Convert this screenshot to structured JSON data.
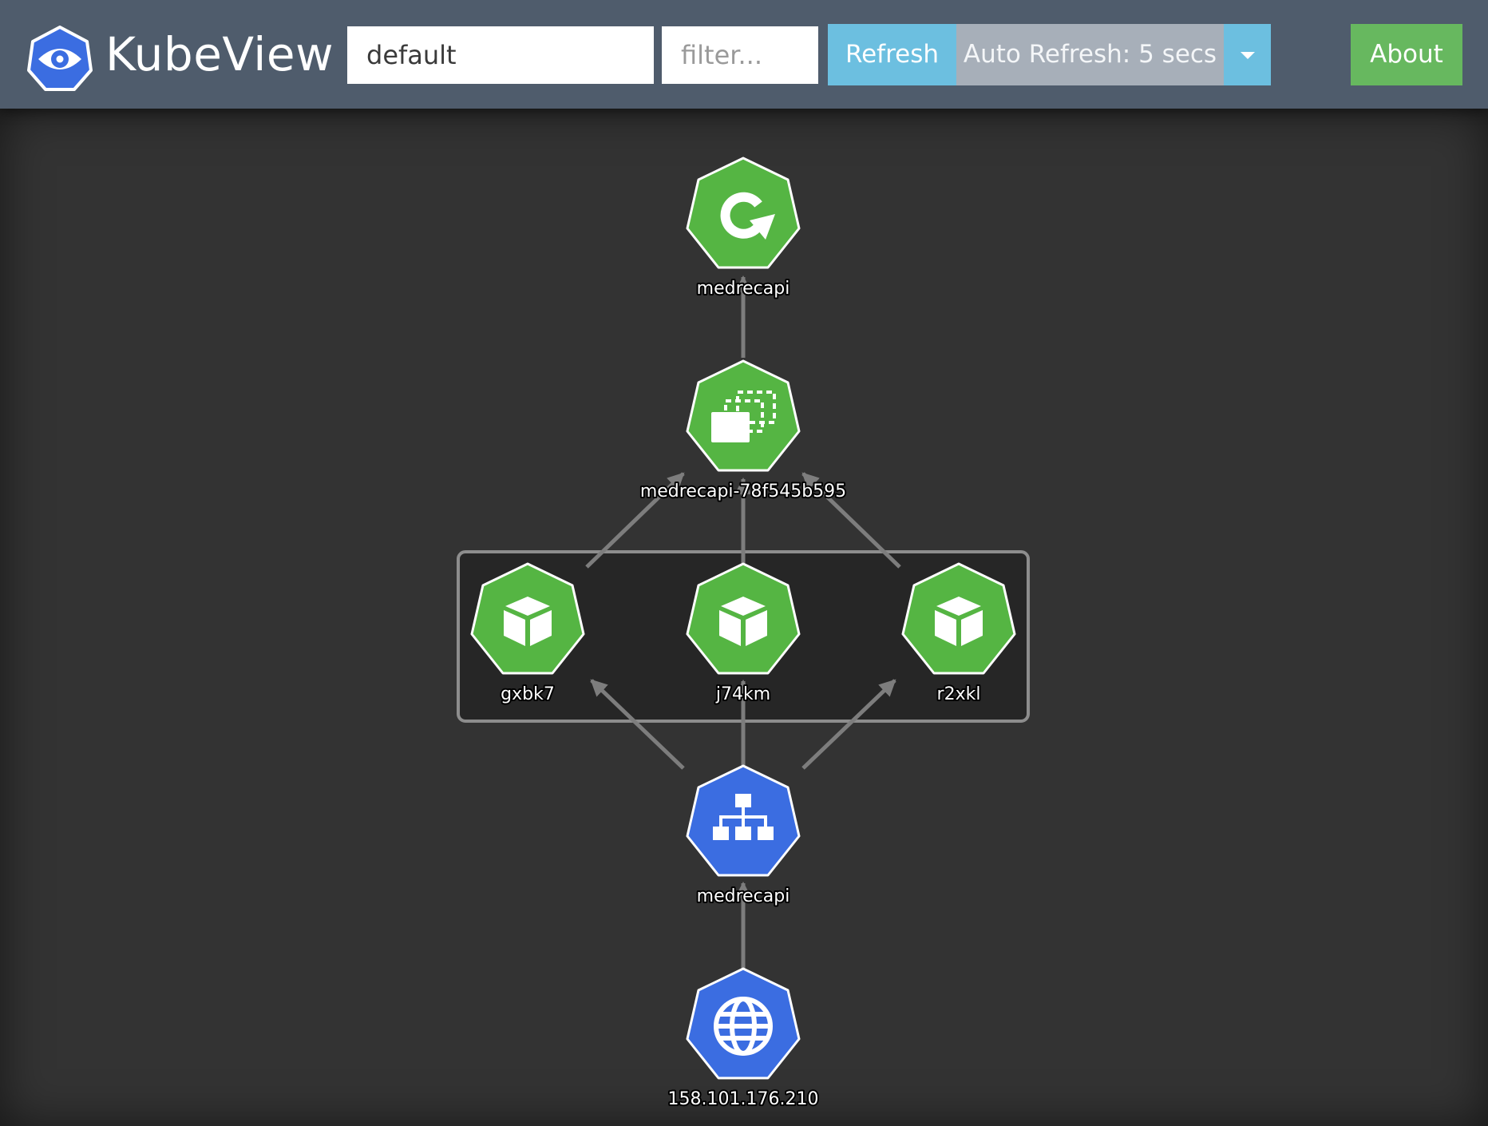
{
  "app": {
    "brand_name": "KubeView",
    "brand_icon": "eye-icon"
  },
  "toolbar": {
    "namespace_value": "default",
    "filter_placeholder": "filter...",
    "refresh_label": "Refresh",
    "auto_refresh_label": "Auto Refresh: 5 secs",
    "dropdown_icon": "caret-down-icon",
    "about_label": "About"
  },
  "graph": {
    "nodes": [
      {
        "id": "deployment",
        "kind": "deployment",
        "icon": "refresh-arrow-icon",
        "label": "medrecapi",
        "color": "#55b543"
      },
      {
        "id": "replicaset",
        "kind": "replicaset",
        "icon": "stacked-windows-icon",
        "label": "medrecapi-78f545b595",
        "color": "#55b543"
      },
      {
        "id": "pod1",
        "kind": "pod",
        "icon": "cube-icon",
        "label": "gxbk7",
        "color": "#55b543"
      },
      {
        "id": "pod2",
        "kind": "pod",
        "icon": "cube-icon",
        "label": "j74km",
        "color": "#55b543"
      },
      {
        "id": "pod3",
        "kind": "pod",
        "icon": "cube-icon",
        "label": "r2xkl",
        "color": "#55b543"
      },
      {
        "id": "service",
        "kind": "service",
        "icon": "network-tree-icon",
        "label": "medrecapi",
        "color": "#3b6de1"
      },
      {
        "id": "ip",
        "kind": "ingress-ip",
        "icon": "globe-icon",
        "label": "158.101.176.210",
        "color": "#3b6de1"
      }
    ],
    "edges": [
      {
        "from": "replicaset",
        "to": "deployment"
      },
      {
        "from": "pod1",
        "to": "replicaset"
      },
      {
        "from": "pod2",
        "to": "replicaset"
      },
      {
        "from": "pod3",
        "to": "replicaset"
      },
      {
        "from": "service",
        "to": "pod1"
      },
      {
        "from": "service",
        "to": "pod2"
      },
      {
        "from": "service",
        "to": "pod3"
      },
      {
        "from": "ip",
        "to": "service"
      }
    ],
    "group": {
      "contains": [
        "pod1",
        "pod2",
        "pod3"
      ]
    }
  }
}
